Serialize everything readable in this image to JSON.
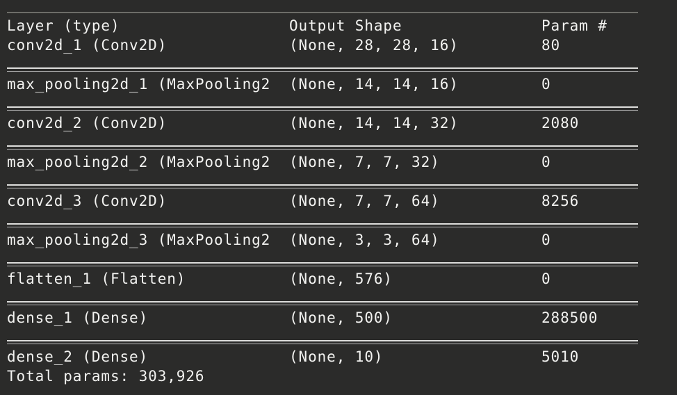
{
  "header": {
    "layer": "Layer (type)",
    "shape": "Output Shape",
    "param": "Param #"
  },
  "rows": [
    {
      "layer": "conv2d_1 (Conv2D)",
      "shape": "(None, 28, 28, 16)",
      "param": "80"
    },
    {
      "layer": "max_pooling2d_1 (MaxPooling2",
      "shape": "(None, 14, 14, 16)",
      "param": "0"
    },
    {
      "layer": "conv2d_2 (Conv2D)",
      "shape": "(None, 14, 14, 32)",
      "param": "2080"
    },
    {
      "layer": "max_pooling2d_2 (MaxPooling2",
      "shape": "(None, 7, 7, 32)",
      "param": "0"
    },
    {
      "layer": "conv2d_3 (Conv2D)",
      "shape": "(None, 7, 7, 64)",
      "param": "8256"
    },
    {
      "layer": "max_pooling2d_3 (MaxPooling2",
      "shape": "(None, 3, 3, 64)",
      "param": "0"
    },
    {
      "layer": "flatten_1 (Flatten)",
      "shape": "(None, 576)",
      "param": "0"
    },
    {
      "layer": "dense_1 (Dense)",
      "shape": "(None, 500)",
      "param": "288500"
    },
    {
      "layer": "dense_2 (Dense)",
      "shape": "(None, 10)",
      "param": "5010"
    }
  ],
  "summary": {
    "total": "Total params: 303,926"
  }
}
